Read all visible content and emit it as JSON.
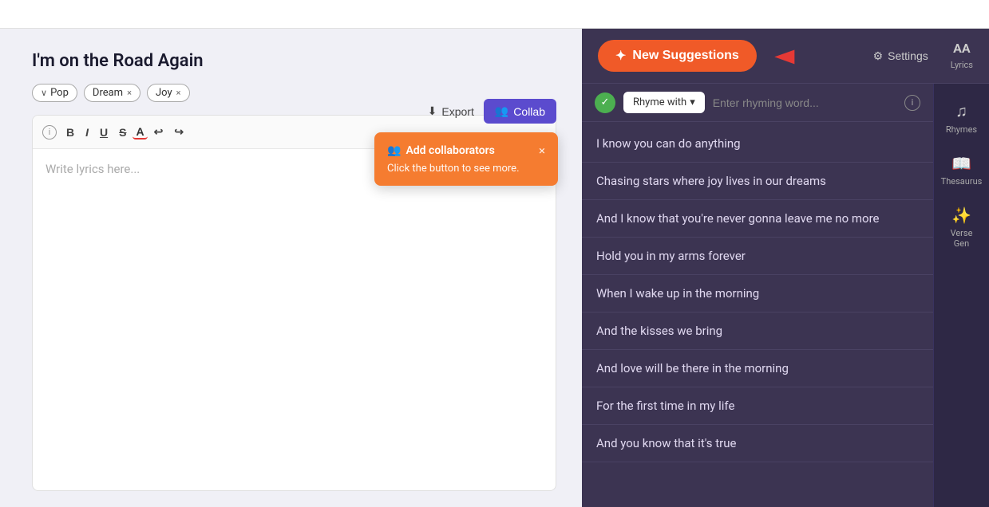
{
  "topbar": {},
  "editor": {
    "title": "I'm on the Road Again",
    "tags": [
      {
        "label": "Pop",
        "hasChevron": true,
        "hasClose": false
      },
      {
        "label": "Dream",
        "hasChevron": false,
        "hasClose": true
      },
      {
        "label": "Joy",
        "hasChevron": false,
        "hasClose": true
      }
    ],
    "export_label": "Export",
    "collab_label": "Collab",
    "placeholder": "Write lyrics here...",
    "toolbar": {
      "bold": "B",
      "italic": "I",
      "underline": "U",
      "strikethrough": "S",
      "color": "A",
      "undo": "↩",
      "redo": "↪"
    }
  },
  "tooltip": {
    "title": "Add collaborators",
    "body": "Click the button to see more.",
    "close": "×"
  },
  "right_panel": {
    "new_suggestions_label": "New Suggestions",
    "settings_label": "Settings",
    "rhyme_with_label": "Rhyme with",
    "rhyme_placeholder": "Enter rhyming word...",
    "suggestions": [
      "I know you can do anything",
      "Chasing stars where joy lives in our dreams",
      "And I know that you're never gonna leave me no more",
      "Hold you in my arms forever",
      "When I wake up in the morning",
      "And the kisses we bring",
      "And love will be there in the morning",
      "For the first time in my life",
      "And you know that it's true"
    ],
    "sidebar_items": [
      {
        "icon": "AA",
        "label": "Lyrics",
        "type": "aa"
      },
      {
        "icon": "♫",
        "label": "Rhymes"
      },
      {
        "icon": "📖",
        "label": "Thesaurus"
      },
      {
        "icon": "✨",
        "label": "Verse Gen"
      }
    ]
  }
}
